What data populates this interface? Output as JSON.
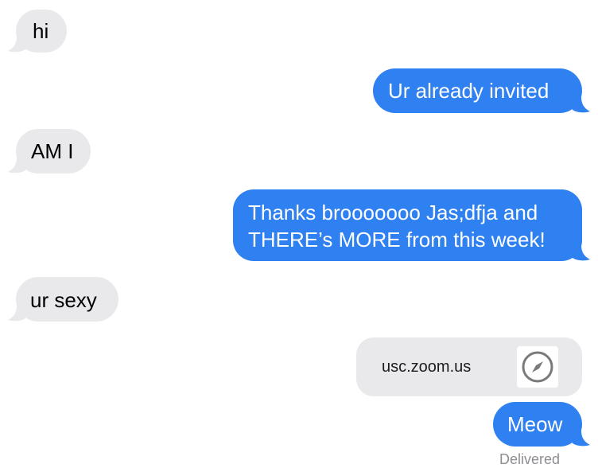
{
  "messages": [
    {
      "direction": "received",
      "text": "hi"
    },
    {
      "direction": "sent",
      "text": "Ur already invited"
    },
    {
      "direction": "received",
      "text": "AM I"
    },
    {
      "direction": "sent",
      "lines": [
        "Thanks brooooooo Jas;dfja and",
        "THERE’s MORE from this week!"
      ]
    },
    {
      "direction": "received",
      "text": "ur sexy"
    },
    {
      "direction": "sent",
      "link": {
        "domain": "usc.zoom.us",
        "icon": "safari-compass-icon"
      }
    },
    {
      "direction": "sent",
      "text": "Meow"
    }
  ],
  "status": {
    "delivered": "Delivered"
  },
  "colors": {
    "sent_bubble": "#2f80f0",
    "received_bubble": "#e9e9eb",
    "sent_text": "#ffffff",
    "received_text": "#000000"
  }
}
